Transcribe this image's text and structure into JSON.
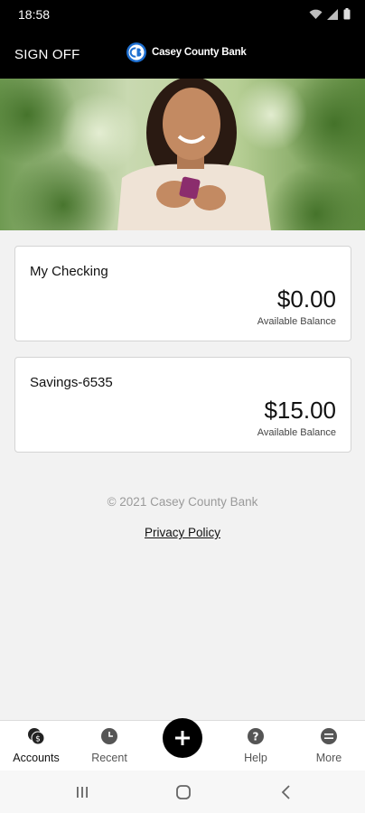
{
  "status_bar": {
    "time": "18:58",
    "icons": [
      "wifi-icon",
      "signal-icon",
      "battery-icon"
    ]
  },
  "header": {
    "sign_off_label": "SIGN OFF",
    "brand_name": "Casey County Bank",
    "logo_icon": "cb-logo-icon"
  },
  "hero": {
    "image": "woman-using-phone-photo"
  },
  "accounts": [
    {
      "name": "My Checking",
      "balance": "$0.00",
      "balance_label": "Available Balance"
    },
    {
      "name": "Savings-6535",
      "balance": "$15.00",
      "balance_label": "Available Balance"
    }
  ],
  "footer": {
    "copyright": "© 2021 Casey County Bank",
    "privacy_label": "Privacy Policy"
  },
  "tab_bar": {
    "tabs": [
      {
        "label": "Accounts",
        "icon": "accounts-icon",
        "active": true
      },
      {
        "label": "Recent",
        "icon": "clock-icon",
        "active": false
      },
      {
        "label": "",
        "icon": "plus-icon",
        "active": false
      },
      {
        "label": "Help",
        "icon": "help-icon",
        "active": false
      },
      {
        "label": "More",
        "icon": "more-icon",
        "active": false
      }
    ]
  },
  "nav_bar": {
    "buttons": [
      "recents-icon",
      "home-icon",
      "back-icon"
    ]
  },
  "colors": {
    "header_bg": "#000000",
    "page_bg": "#f2f2f2",
    "card_border": "#d4d4d4",
    "brand_blue": "#1e6fd0"
  }
}
